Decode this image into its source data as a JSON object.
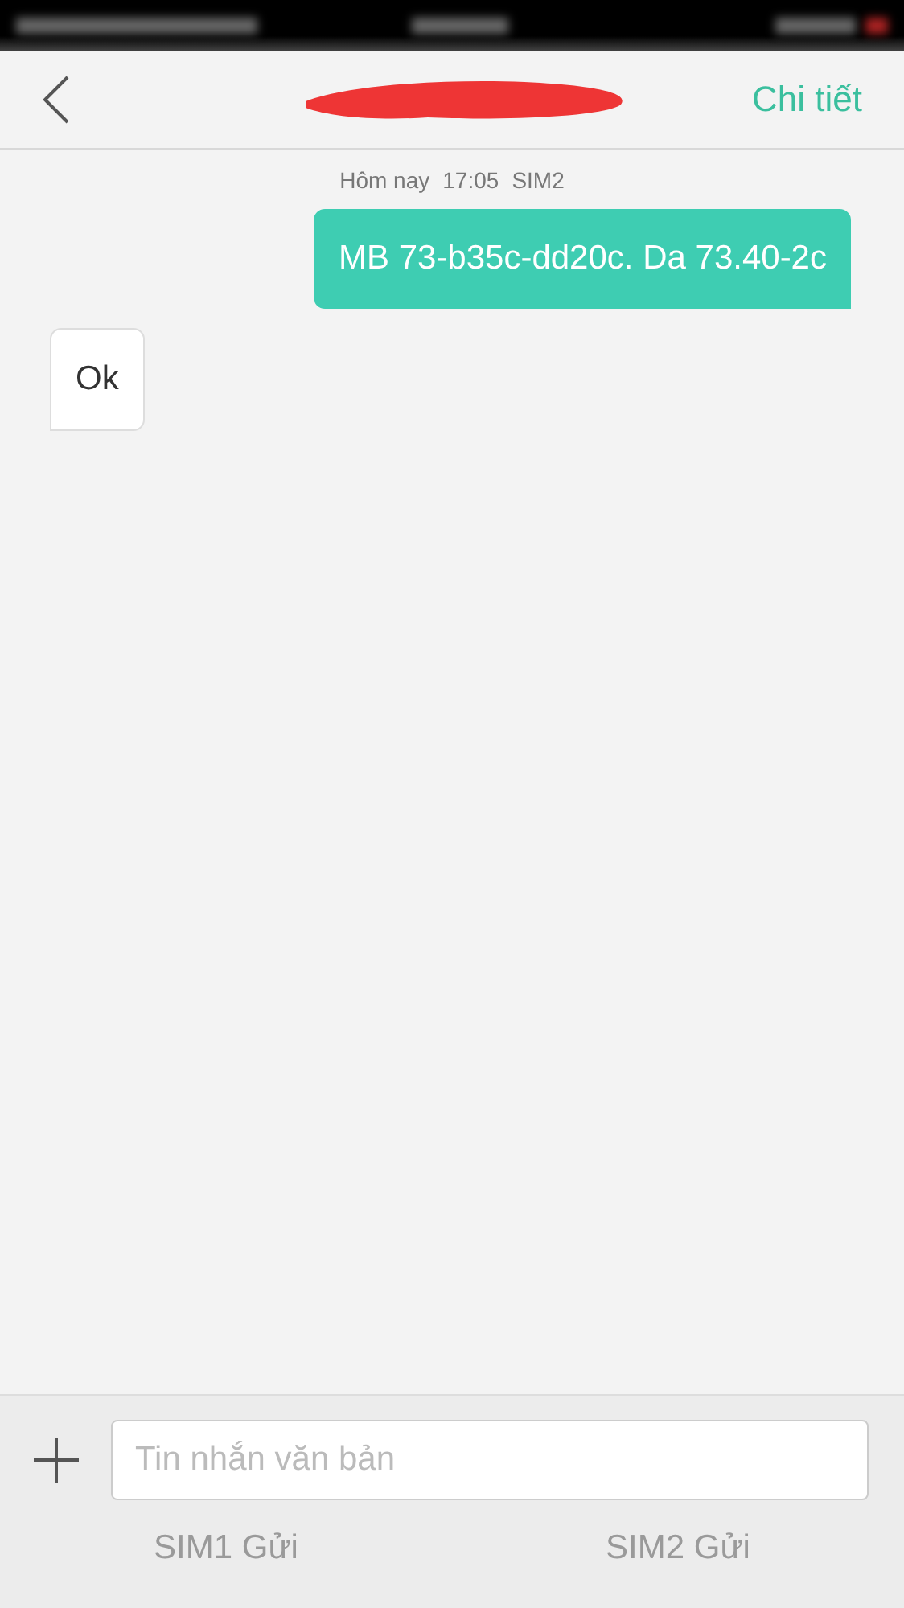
{
  "header": {
    "action": "Chi tiết"
  },
  "thread": {
    "timestamp": [
      {
        "text": "Hôm nay"
      },
      {
        "text": "17:05"
      },
      {
        "text": "SIM2"
      }
    ],
    "messages": [
      {
        "kind": "sent",
        "text": "MB 73-b35c-dd20c. Da 73.40-2c"
      },
      {
        "kind": "received",
        "text": "Ok"
      }
    ]
  },
  "compose": {
    "placeholder": "Tin nhắn văn bản",
    "send_buttons": [
      {
        "label": "SIM1 Gửi",
        "disabled": true
      },
      {
        "label": "SIM2 Gửi",
        "disabled": true
      }
    ]
  }
}
